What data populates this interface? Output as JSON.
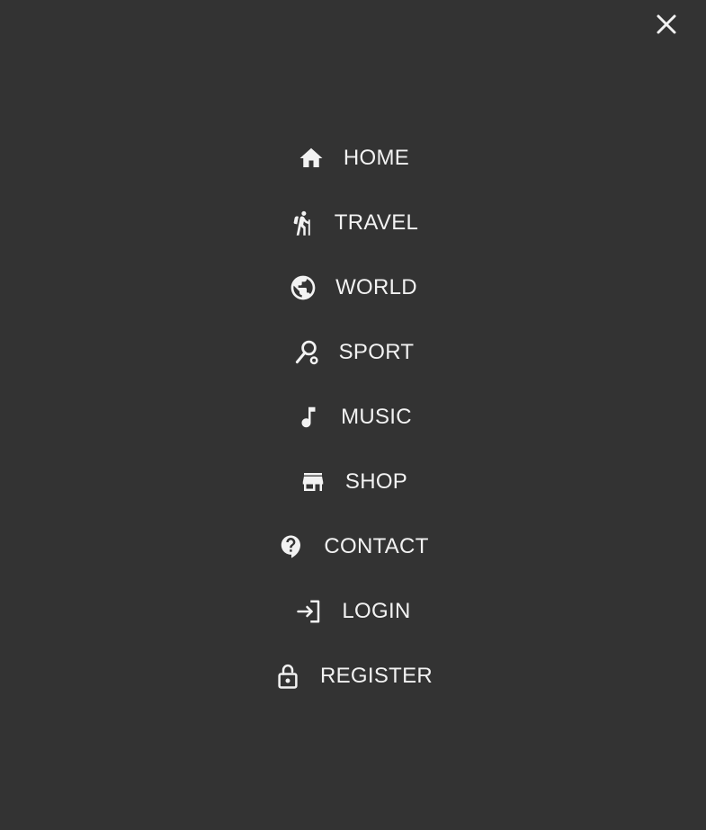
{
  "colors": {
    "background": "#333333",
    "text": "#f2f2f2"
  },
  "close": {
    "icon": "close-icon"
  },
  "menu": {
    "items": [
      {
        "label": "HOME",
        "icon": "home-icon"
      },
      {
        "label": "TRAVEL",
        "icon": "hiking-icon"
      },
      {
        "label": "WORLD",
        "icon": "globe-icon"
      },
      {
        "label": "SPORT",
        "icon": "sports-tennis-icon"
      },
      {
        "label": "MUSIC",
        "icon": "music-note-icon"
      },
      {
        "label": "SHOP",
        "icon": "store-icon"
      },
      {
        "label": "CONTACT",
        "icon": "contact-support-icon"
      },
      {
        "label": "LOGIN",
        "icon": "login-icon"
      },
      {
        "label": "REGISTER",
        "icon": "lock-open-icon"
      }
    ]
  }
}
